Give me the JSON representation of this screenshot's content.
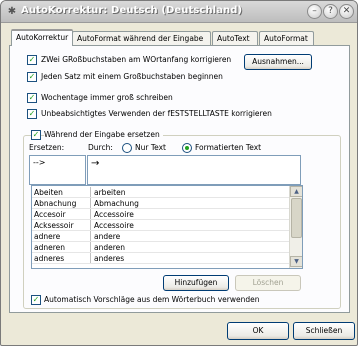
{
  "window": {
    "title": "AutoKorrektur: Deutsch (Deutschland)"
  },
  "tabs": [
    {
      "label": "AutoKorrektur",
      "active": true
    },
    {
      "label": "AutoFormat während der Eingabe",
      "active": false
    },
    {
      "label": "AutoText",
      "active": false
    },
    {
      "label": "AutoFormat",
      "active": false
    }
  ],
  "options": {
    "zwei_gross": "ZWei GRoßbuchstaben am WOrtanfang korrigieren",
    "satzanfang": "Jeden Satz mit einem Großbuchstaben beginnen",
    "wochentage": "Wochentage immer groß schreiben",
    "feststelltaste": "Unbeabsichtigtes Verwenden der fESTSTELLTASTE korrigieren",
    "ersetzen": "Während der Eingabe ersetzen"
  },
  "buttons": {
    "ausnahmen": "Ausnahmen...",
    "hinzufuegen": "Hinzufügen",
    "loeschen": "Löschen",
    "ok": "OK",
    "schliessen": "Schließen"
  },
  "replace": {
    "ersetzen_label": "Ersetzen:",
    "durch_label": "Durch:",
    "nur_text": "Nur Text",
    "formatierten_text": "Formatierten Text",
    "ersetzen_value": "-->",
    "durch_value": "→"
  },
  "list_rows": [
    [
      "Abeiten",
      "arbeiten"
    ],
    [
      "Abnachung",
      "Abmachung"
    ],
    [
      "Accesoir",
      "Accessoire"
    ],
    [
      "Acksessoir",
      "Accessoire"
    ],
    [
      "adnere",
      "andere"
    ],
    [
      "adneren",
      "anderen"
    ],
    [
      "adneres",
      "anderes"
    ]
  ],
  "wortebuch_option": "Automatisch Vorschläge aus dem Wörterbuch verwenden"
}
